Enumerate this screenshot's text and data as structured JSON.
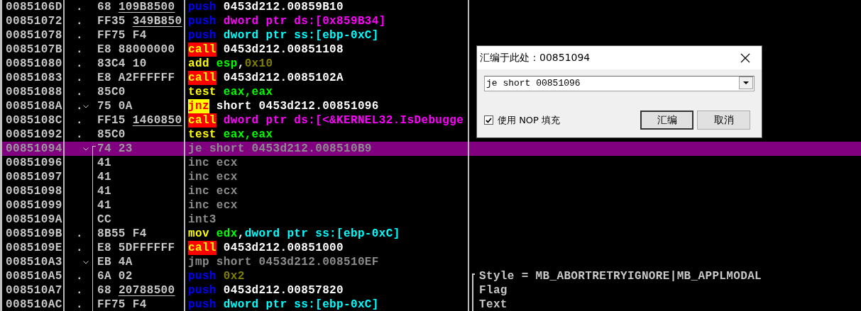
{
  "rows": [
    {
      "address": "0085106D",
      "marker": ".",
      "jump_arrow": false,
      "jump_line": false,
      "hex": "68",
      "reloc": "109B8500",
      "selected": false,
      "mnemonic": {
        "text": "push",
        "kind": "push"
      },
      "operands": [
        {
          "text": "0453d212.00859B10",
          "kind": "plain"
        }
      ]
    },
    {
      "address": "00851072",
      "marker": ".",
      "jump_arrow": false,
      "jump_line": false,
      "hex": "FF35",
      "reloc": "349B850",
      "selected": false,
      "mnemonic": {
        "text": "push",
        "kind": "push"
      },
      "operands": [
        {
          "text": "dword ptr ds:[0x859B34]",
          "kind": "mem"
        }
      ]
    },
    {
      "address": "00851078",
      "marker": ".",
      "jump_arrow": false,
      "jump_line": false,
      "hex": "FF75 F4",
      "selected": false,
      "mnemonic": {
        "text": "push",
        "kind": "push"
      },
      "operands": [
        {
          "text": "dword ptr ss:[ebp-0xC]",
          "kind": "stack"
        }
      ]
    },
    {
      "address": "0085107B",
      "marker": ".",
      "jump_arrow": false,
      "jump_line": false,
      "hex": "E8 88000000",
      "selected": false,
      "mnemonic": {
        "text": "call",
        "kind": "call"
      },
      "operands": [
        {
          "text": "0453d212.00851108",
          "kind": "plain"
        }
      ]
    },
    {
      "address": "00851080",
      "marker": ".",
      "jump_arrow": false,
      "jump_line": false,
      "hex": "83C4 10",
      "selected": false,
      "mnemonic": {
        "text": "add",
        "kind": "op"
      },
      "operands": [
        {
          "text": "esp",
          "kind": "reg"
        },
        {
          "text": ",",
          "kind": "plain"
        },
        {
          "text": "0x10",
          "kind": "const"
        }
      ]
    },
    {
      "address": "00851083",
      "marker": ".",
      "jump_arrow": false,
      "jump_line": false,
      "hex": "E8 A2FFFFFF",
      "selected": false,
      "mnemonic": {
        "text": "call",
        "kind": "call"
      },
      "operands": [
        {
          "text": "0453d212.0085102A",
          "kind": "plain"
        }
      ]
    },
    {
      "address": "00851088",
      "marker": ".",
      "jump_arrow": false,
      "jump_line": false,
      "hex": "85C0",
      "selected": false,
      "mnemonic": {
        "text": "test",
        "kind": "op"
      },
      "operands": [
        {
          "text": "eax,eax",
          "kind": "reg"
        }
      ]
    },
    {
      "address": "0085108A",
      "marker": ".",
      "jump_arrow": true,
      "jump_line": false,
      "hex": "75 0A",
      "selected": false,
      "mnemonic": {
        "text": "jnz",
        "kind": "jcc"
      },
      "operands": [
        {
          "text": "short 0453d212.00851096",
          "kind": "plain"
        }
      ]
    },
    {
      "address": "0085108C",
      "marker": ".",
      "jump_arrow": false,
      "jump_line": false,
      "hex": "FF15",
      "reloc": "1460850",
      "selected": false,
      "mnemonic": {
        "text": "call",
        "kind": "call"
      },
      "operands": [
        {
          "text": "dword ptr ds:[<&KERNEL32.IsDebugge",
          "kind": "mem"
        }
      ]
    },
    {
      "address": "00851092",
      "marker": ".",
      "jump_arrow": false,
      "jump_line": false,
      "hex": "85C0",
      "selected": false,
      "mnemonic": {
        "text": "test",
        "kind": "op"
      },
      "operands": [
        {
          "text": "eax,eax",
          "kind": "reg"
        }
      ]
    },
    {
      "address": "00851094",
      "jump_arrow": true,
      "jump_line": true,
      "jump_start": true,
      "hex": "74 23",
      "selected": true,
      "mnemonic": {
        "text": "je",
        "kind": "dim"
      },
      "operands": [
        {
          "text": "short 0453d212.008510B9",
          "kind": "dim"
        }
      ]
    },
    {
      "address": "00851096",
      "jump_arrow": false,
      "jump_line": true,
      "jump_start": false,
      "hex": "41",
      "selected": false,
      "mnemonic": {
        "text": "inc",
        "kind": "dim"
      },
      "operands": [
        {
          "text": "ecx",
          "kind": "dim"
        }
      ]
    },
    {
      "address": "00851097",
      "jump_arrow": false,
      "jump_line": true,
      "jump_start": false,
      "hex": "41",
      "selected": false,
      "mnemonic": {
        "text": "inc",
        "kind": "dim"
      },
      "operands": [
        {
          "text": "ecx",
          "kind": "dim"
        }
      ]
    },
    {
      "address": "00851098",
      "jump_arrow": false,
      "jump_line": true,
      "jump_start": false,
      "hex": "41",
      "selected": false,
      "mnemonic": {
        "text": "inc",
        "kind": "dim"
      },
      "operands": [
        {
          "text": "ecx",
          "kind": "dim"
        }
      ]
    },
    {
      "address": "00851099",
      "jump_arrow": false,
      "jump_line": true,
      "jump_start": false,
      "hex": "41",
      "selected": false,
      "mnemonic": {
        "text": "inc",
        "kind": "dim"
      },
      "operands": [
        {
          "text": "ecx",
          "kind": "dim"
        }
      ]
    },
    {
      "address": "0085109A",
      "jump_arrow": false,
      "jump_line": true,
      "jump_start": false,
      "hex": "CC",
      "selected": false,
      "mnemonic": {
        "text": "int3",
        "kind": "dim"
      },
      "operands": []
    },
    {
      "address": "0085109B",
      "marker": ".",
      "jump_arrow": false,
      "jump_line": true,
      "jump_start": false,
      "hex": "8B55 F4",
      "selected": false,
      "mnemonic": {
        "text": "mov",
        "kind": "op"
      },
      "operands": [
        {
          "text": "edx",
          "kind": "reg"
        },
        {
          "text": ",",
          "kind": "plain"
        },
        {
          "text": "dword ptr ss:[ebp-0xC]",
          "kind": "stack"
        }
      ]
    },
    {
      "address": "0085109E",
      "marker": ".",
      "jump_arrow": false,
      "jump_line": true,
      "jump_start": false,
      "hex": "E8 5DFFFFFF",
      "selected": false,
      "mnemonic": {
        "text": "call",
        "kind": "call"
      },
      "operands": [
        {
          "text": "0453d212.00851000",
          "kind": "plain"
        }
      ]
    },
    {
      "address": "008510A3",
      "jump_arrow": true,
      "jump_line": true,
      "jump_start": false,
      "hex": "EB 4A",
      "selected": false,
      "mnemonic": {
        "text": "jmp",
        "kind": "dim"
      },
      "operands": [
        {
          "text": "short 0453d212.008510EF",
          "kind": "dim"
        }
      ]
    },
    {
      "address": "008510A5",
      "marker": ".",
      "jump_arrow": false,
      "jump_line": true,
      "jump_start": false,
      "hex": "6A 02",
      "selected": false,
      "mnemonic": {
        "text": "push",
        "kind": "push"
      },
      "operands": [
        {
          "text": "0x2",
          "kind": "const"
        }
      ],
      "comment": "Style = MB_ABORTRETRYIGNORE|MB_APPLMODAL",
      "bracket_top": true
    },
    {
      "address": "008510A7",
      "marker": ".",
      "jump_arrow": false,
      "jump_line": true,
      "jump_start": false,
      "hex": "68",
      "reloc": "20788500",
      "selected": false,
      "mnemonic": {
        "text": "push",
        "kind": "push"
      },
      "operands": [
        {
          "text": "0453d212.00857820",
          "kind": "plain"
        }
      ],
      "comment": "Flag",
      "bracket_top": false
    },
    {
      "address": "008510AC",
      "marker": ".",
      "jump_arrow": false,
      "jump_line": true,
      "jump_start": false,
      "hex": "FF75 F4",
      "selected": false,
      "mnemonic": {
        "text": "push",
        "kind": "push"
      },
      "operands": [
        {
          "text": "dword ptr ss:[ebp-0xC]",
          "kind": "stack"
        }
      ],
      "comment": "Text",
      "bracket_top": false
    }
  ],
  "dialog": {
    "title": "汇编于此处：00851094",
    "input": {
      "value": "je short 00851096"
    },
    "checkbox": {
      "label": "使用 NOP 填充",
      "checked": true
    },
    "buttons": [
      {
        "label": "汇编",
        "default": true
      },
      {
        "label": "取消",
        "default": false
      }
    ]
  }
}
